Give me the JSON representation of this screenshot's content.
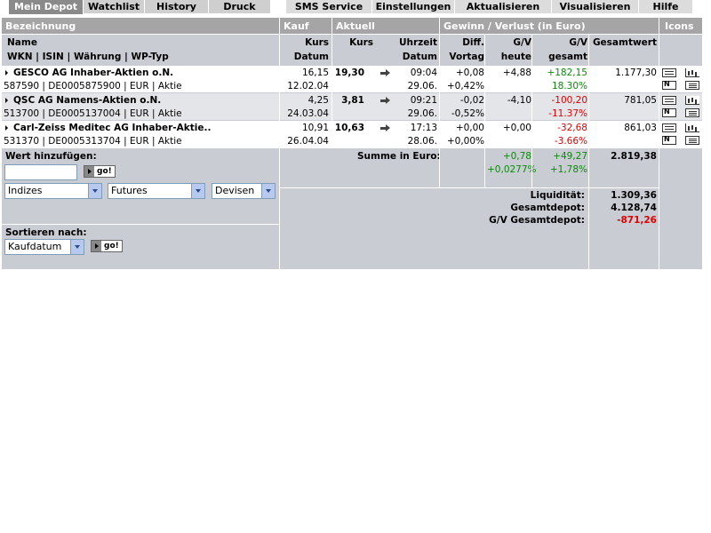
{
  "tabs": [
    {
      "label": "Mein Depot"
    },
    {
      "label": "Watchlist"
    },
    {
      "label": "History"
    },
    {
      "label": "Druck"
    },
    {
      "label": "SMS Service"
    },
    {
      "label": "Einstellungen"
    },
    {
      "label": "Aktualisieren"
    },
    {
      "label": "Visualisieren"
    },
    {
      "label": "Hilfe"
    }
  ],
  "header": {
    "bezeichnung": "Bezeichnung",
    "kauf": "Kauf",
    "aktuell": "Aktuell",
    "gewinn": "Gewinn / Verlust  (in Euro)",
    "icons": "Icons"
  },
  "subheader": {
    "name": "Name",
    "wkn": "WKN | ISIN | Währung | WP-Typ",
    "kurs1": "Kurs",
    "datum1": "Datum",
    "kurs2": "Kurs",
    "uhrzeit": "Uhrzeit",
    "datum2": "Datum",
    "diff1": "Diff.",
    "diff2": "Vortag",
    "gvheute1": "G/V",
    "gvheute2": "heute",
    "gvgesamt1": "G/V",
    "gvgesamt2": "gesamt",
    "gesamtwert": "Gesamtwert"
  },
  "rows": [
    {
      "name": "GESCO AG Inhaber-Aktien o.N.",
      "meta": "587590 | DE0005875900 | EUR | Aktie",
      "kauf_kurs": "16,15",
      "kauf_datum": "12.02.04",
      "kurs": "19,30",
      "uhrzeit": "09:04",
      "datum": "29.06.",
      "diff": "+0,08",
      "diff_pct": "+0,42%",
      "gv_heute": "+4,88",
      "gv_gesamt": "+182,15",
      "gv_gesamt_pct": "18.30%",
      "gesamtwert": "1.177,30"
    },
    {
      "name": "QSC AG Namens-Aktien o.N.",
      "meta": "513700 | DE0005137004 | EUR | Aktie",
      "kauf_kurs": "4,25",
      "kauf_datum": "24.03.04",
      "kurs": "3,81",
      "uhrzeit": "09:21",
      "datum": "29.06.",
      "diff": "-0,02",
      "diff_pct": "-0,52%",
      "gv_heute": "-4,10",
      "gv_gesamt": "-100,20",
      "gv_gesamt_pct": "-11.37%",
      "gesamtwert": "781,05"
    },
    {
      "name": "Carl-Zeiss Meditec AG Inhaber-Aktie..",
      "meta": "531370 | DE0005313704 | EUR | Aktie",
      "kauf_kurs": "10,91",
      "kauf_datum": "26.04.04",
      "kurs": "10,63",
      "uhrzeit": "17:13",
      "datum": "28.06.",
      "diff": "+0,00",
      "diff_pct": "+0,00%",
      "gv_heute": "+0,00",
      "gv_gesamt": "-32,68",
      "gv_gesamt_pct": "-3.66%",
      "gesamtwert": "861,03"
    }
  ],
  "add": {
    "label": "Wert hinzufügen:",
    "go": "go!",
    "select1": "Indizes",
    "select2": "Futures",
    "select3": "Devisen"
  },
  "sort": {
    "label": "Sortieren nach:",
    "value": "Kaufdatum",
    "go": "go!"
  },
  "summary": {
    "summe_label": "Summe in Euro:",
    "gv_heute": "+0,78",
    "gv_heute_pct": "+0,0277%",
    "gv_gesamt": "+49,27",
    "gv_gesamt_pct": "+1,78%",
    "gesamtwert": "2.819,38",
    "liquiditaet_label": "Liquidität:",
    "liquiditaet": "1.309,36",
    "gesamtdepot_label": "Gesamtdepot:",
    "gesamtdepot": "4.128,74",
    "gv_gesamtdepot_label": "G/V Gesamtdepot:",
    "gv_gesamtdepot": "-871,26"
  },
  "colors": {
    "header_bg": "#a5a5a5",
    "subheader_bg": "#c9cdd3",
    "row_alt_bg": "#e4e5e8",
    "positive": "#0a8a0a",
    "negative": "#e00000"
  }
}
